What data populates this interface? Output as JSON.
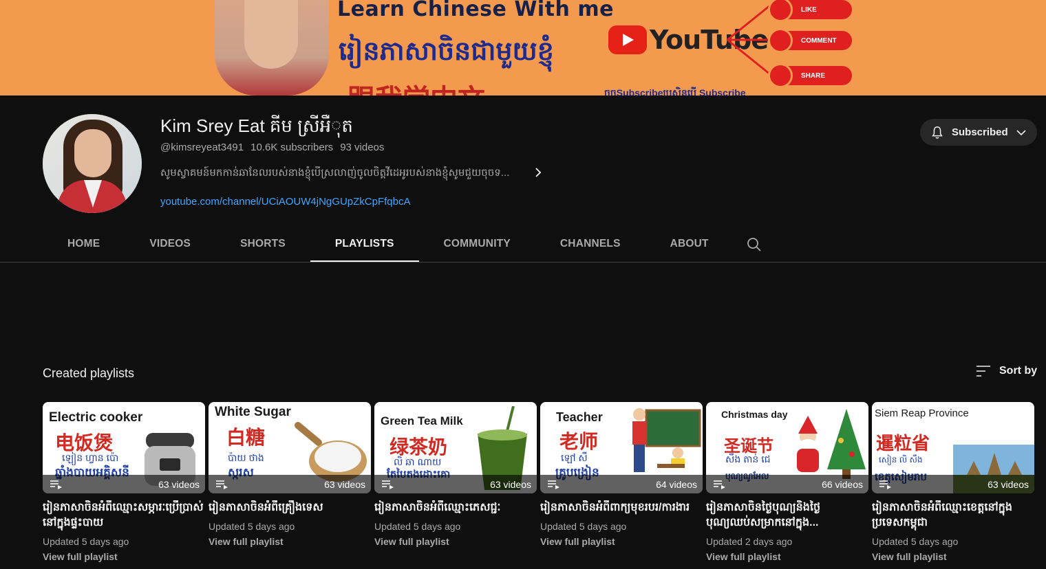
{
  "banner": {
    "title": "Learn Chinese With me",
    "khmer": "រៀនភាសាចិនជាមួយខ្ញុំ",
    "chinese": "跟我学中文",
    "yt_word": "YouTube",
    "pills": [
      "LIKE",
      "COMMENT",
      "SHARE"
    ],
    "subline": "ចុចSubscribeប្រសិនបើ Subscribe"
  },
  "channel": {
    "name": "Kim Srey Eat គីម ស្រីអឺុត",
    "handle": "@kimsreyeat3491",
    "subscribers": "10.6K subscribers",
    "videos": "93 videos",
    "description": "សូមស្វាគមន៍មកកាន់ឆានែលរបស់នាងខ្ញុំបើស្រលាញ់ចូលចិត្តវីដេអូរបស់នាងខ្ញុំសូមជួយចុចទ...",
    "link": "youtube.com/channel/UCiAOUW4jNgGUpZkCpFfqbcA",
    "subscribe_label": "Subscribed"
  },
  "tabs": [
    "HOME",
    "VIDEOS",
    "SHORTS",
    "PLAYLISTS",
    "COMMUNITY",
    "CHANNELS",
    "ABOUT"
  ],
  "active_tab": "PLAYLISTS",
  "section": {
    "title": "Created playlists",
    "sort_label": "Sort by"
  },
  "playlists": [
    {
      "thumb_en": "Electric cooker",
      "thumb_zh": "电饭煲",
      "thumb_km": "ឡៀន ហ្វាន ប៉ោ",
      "thumb_km2": "ឆ្នាំងបាយអគ្គិសនី",
      "count": "63 videos",
      "title": "រៀនភាសាចិនអំពីឈ្មោះសម្ភារៈប្រើប្រាស់នៅក្នុងផ្ទះបាយ",
      "updated": "Updated 5 days ago",
      "view": "View full playlist"
    },
    {
      "thumb_en": "White Sugar",
      "thumb_zh": "白糖",
      "thumb_km": "ប៉ាយ ថាង",
      "thumb_km2": "ស្ករស",
      "count": "63 videos",
      "title": "រៀនភាសាចិនអំពីគ្រឿងទេស",
      "updated": "Updated 5 days ago",
      "view": "View full playlist"
    },
    {
      "thumb_en": "Green Tea Milk",
      "thumb_zh": "绿茶奶",
      "thumb_km": "លិ ឆា ណាយ",
      "thumb_km2": "តែបៃតងដោះគោ",
      "count": "63 videos",
      "title": "រៀនភាសាចិនអំពីឈ្មោះភេសជ្ជៈ",
      "updated": "Updated 5 days ago",
      "view": "View full playlist"
    },
    {
      "thumb_en": "Teacher",
      "thumb_zh": "老师",
      "thumb_km": "ឡៅ សឺ",
      "thumb_km2": "គ្រូបង្រៀន",
      "count": "64 videos",
      "title": "រៀនភាសាចិនអំពីពាក្យមុខរបរ/ការងារ",
      "updated": "Updated 5 days ago",
      "view": "View full playlist"
    },
    {
      "thumb_en": "Christmas day",
      "thumb_zh": "圣诞节",
      "thumb_km": "សឹង តាន់ ជេ",
      "thumb_km2": "បុណ្យណូអែល",
      "count": "66 videos",
      "title": "រៀនភាសាចិនថ្ងៃបុណ្យនិងថ្ងៃបុណ្យឈប់សម្រាកនៅក្នុង...",
      "updated": "Updated 2 days ago",
      "view": "View full playlist"
    },
    {
      "thumb_en": "Siem Reap Province",
      "thumb_zh": "暹粒省",
      "thumb_km": "សៀន លិ សឹង",
      "thumb_km2": "ខេត្តសៀមរាប",
      "count": "63 videos",
      "title": "រៀនភាសាចិនអំពីឈ្មោះខេត្តនៅក្នុងប្រទេសកម្ពុជា",
      "updated": "Updated 5 days ago",
      "view": "View full playlist"
    }
  ],
  "colors": {
    "background": "#0f0f0f",
    "link": "#3ea6ff",
    "banner": "#f39a4e",
    "muted": "#aaaaaa"
  }
}
